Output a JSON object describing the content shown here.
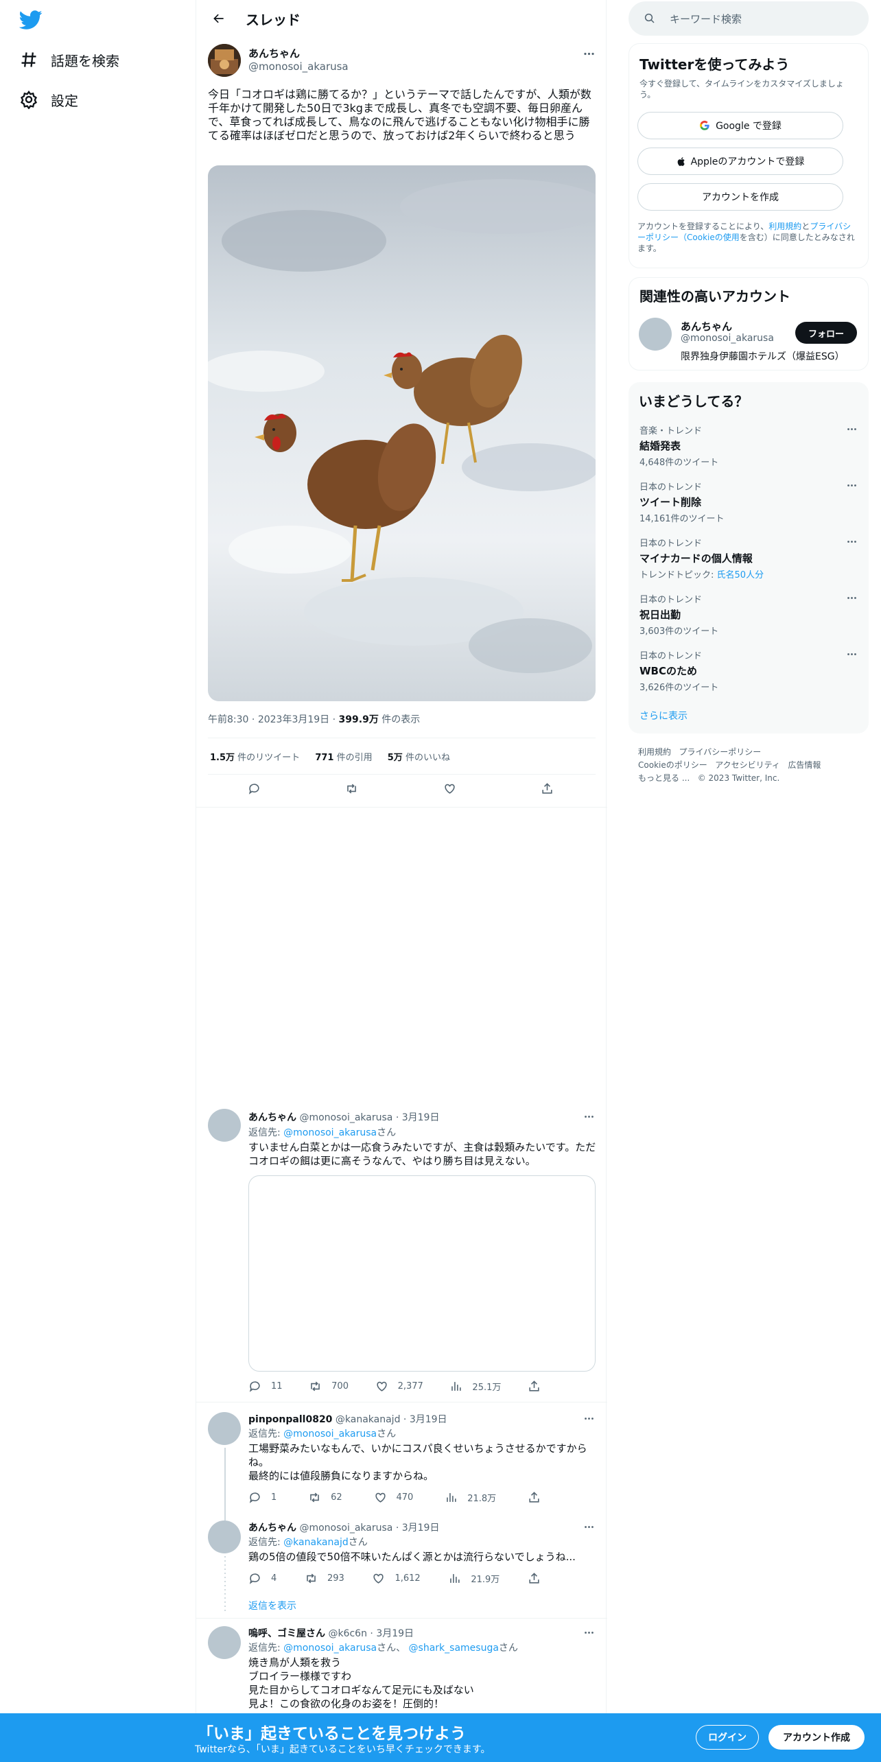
{
  "nav": {
    "explore": "話題を検索",
    "settings": "設定"
  },
  "header": {
    "title": "スレッド"
  },
  "tweet": {
    "name": "あんちゃん",
    "handle": "@monosoi_akarusa",
    "text": "今日「コオロギは鶏に勝てるか？」というテーマで話したんですが、人類が数千年かけて開発した50日で3kgまで成長し、真冬でも空調不要、毎日卵産んで、草食ってれば成長して、鳥なのに飛んで逃げることもない化け物相手に勝てる確率はほぼゼロだと思うので、放っておけば2年くらいで終わると思う",
    "time": "午前8:30",
    "date": "2023年3月19日",
    "views": "399.9万",
    "views_label": "件の表示",
    "retweets": "1.5万",
    "retweets_label": "件のリツイート",
    "quotes": "771",
    "quotes_label": "件の引用",
    "likes": "5万",
    "likes_label": "件のいいね"
  },
  "replies": [
    {
      "name": "あんちゃん",
      "handle": "@monosoi_akarusa",
      "date": "3月19日",
      "to_label": "返信先:",
      "to": "@monosoi_akarusa",
      "san": "さん",
      "text": "すいません白菜とかは一応食うみたいですが、主食は穀類みたいです。ただコオロギの餌は更に高そうなんで、やはり勝ち目は見えない。",
      "replies": "11",
      "retweets": "700",
      "likes": "2,377",
      "views": "25.1万"
    },
    {
      "name": "pinponpall0820",
      "handle": "@kanakanajd",
      "date": "3月19日",
      "to_label": "返信先:",
      "to": "@monosoi_akarusa",
      "san": "さん",
      "text1": "工場野菜みたいなもんで、いかにコスパ良くせいちょうさせるかですからね。",
      "text2": "最終的には値段勝負になりますからね。",
      "replies": "1",
      "retweets": "62",
      "likes": "470",
      "views": "21.8万"
    },
    {
      "name": "あんちゃん",
      "handle": "@monosoi_akarusa",
      "date": "3月19日",
      "to_label": "返信先:",
      "to": "@kanakanajd",
      "san": "さん",
      "text": "鶏の5倍の値段で50倍不味いたんぱく源とかは流行らないでしょうね...",
      "replies": "4",
      "retweets": "293",
      "likes": "1,612",
      "views": "21.9万",
      "show_replies": "返信を表示"
    },
    {
      "name": "嗚呼、ゴミ屋さん",
      "handle": "@k6c6n",
      "date": "3月19日",
      "to_label": "返信先:",
      "to": "@monosoi_akarusa",
      "san": "さん、",
      "to2": "@shark_samesuga",
      "san2": "さん",
      "line1": "焼き鳥が人類を救う",
      "line2": "ブロイラー様様ですわ",
      "line3": "見た目からしてコオロギなんて足元にも及ばない",
      "line4": "見よ！この食欲の化身のお姿を！圧倒的！"
    }
  ],
  "right": {
    "search_placeholder": "キーワード検索",
    "signup": {
      "title": "Twitterを使ってみよう",
      "subtitle": "今すぐ登録して、タイムラインをカスタマイズしましょう。",
      "google": "Google で登録",
      "apple": "Appleのアカウントで登録",
      "create": "アカウントを作成",
      "terms_a": "アカウントを登録することにより、",
      "terms_link1": "利用規約",
      "terms_b": "と",
      "terms_link2": "プライバシーポリシー（Cookieの使用",
      "terms_c": "を含む）に同意したとみなされます。"
    },
    "related": {
      "title": "関連性の高いアカウント",
      "name": "あんちゃん",
      "handle": "@monosoi_akarusa",
      "follow": "フォロー",
      "bio": "限界独身伊藤園ホテルズ（爆益ESG）"
    },
    "trends": {
      "title": "いまどうしてる？",
      "items": [
        {
          "context": "音楽・トレンド",
          "name": "結婚発表",
          "count": "4,648件のツイート"
        },
        {
          "context": "日本のトレンド",
          "name": "ツイート削除",
          "count": "14,161件のツイート"
        },
        {
          "context": "日本のトレンド",
          "name": "マイナカードの個人情報",
          "topic_label": "トレンドトピック:",
          "topic": "氏名50人分"
        },
        {
          "context": "日本のトレンド",
          "name": "祝日出勤",
          "count": "3,603件のツイート"
        },
        {
          "context": "日本のトレンド",
          "name": "WBCのため",
          "count": "3,626件のツイート"
        }
      ],
      "more": "さらに表示"
    },
    "footer": {
      "terms": "利用規約",
      "privacy": "プライバシーポリシー",
      "cookie": "Cookieのポリシー",
      "access": "アクセシビリティ",
      "ads": "広告情報",
      "more": "もっと見る ...",
      "copy": "© 2023 Twitter, Inc."
    }
  },
  "bottom": {
    "title": "「いま」起きていることを見つけよう",
    "subtitle": "Twitterなら、「いま」起きていることをいち早くチェックできます。",
    "login": "ログイン",
    "signup": "アカウント作成"
  },
  "colors": {
    "accent": "#1d9bf0",
    "text": "#0f1419",
    "muted": "#536471"
  }
}
